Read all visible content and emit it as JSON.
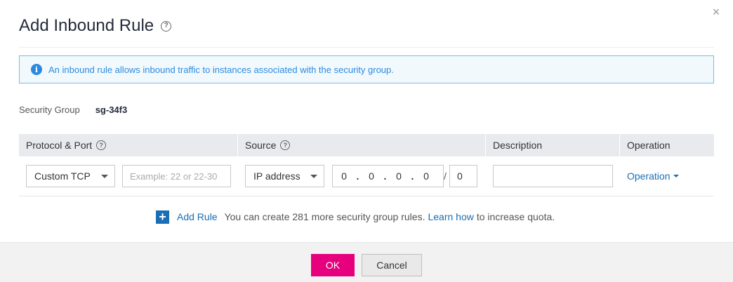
{
  "dialog": {
    "title": "Add Inbound Rule",
    "help_glyph": "?",
    "close_glyph": "×"
  },
  "info": {
    "icon_glyph": "i",
    "text": "An inbound rule allows inbound traffic to instances associated with the security group."
  },
  "security_group": {
    "label": "Security Group",
    "value": "sg-34f3"
  },
  "table": {
    "headers": {
      "protocol_port": "Protocol & Port",
      "source": "Source",
      "description": "Description",
      "operation": "Operation"
    },
    "row": {
      "protocol": "Custom TCP",
      "port_placeholder": "Example: 22 or 22-30",
      "port_value": "",
      "source_type": "IP address",
      "ip": [
        "0",
        "0",
        "0",
        "0"
      ],
      "ip_dot": ".",
      "mask_separator": "/",
      "mask": "0",
      "description": "",
      "operation_label": "Operation"
    }
  },
  "add_rule": {
    "icon_glyph": "+",
    "label": "Add Rule",
    "quota_text": "You can create 281 more security group rules.",
    "learn_link": "Learn how",
    "quota_suffix": "to increase quota."
  },
  "footer": {
    "ok_label": "OK",
    "cancel_label": "Cancel"
  },
  "colors": {
    "accent_pink": "#e6007e",
    "link_blue": "#1b6eb5",
    "info_blue": "#2b8ae0",
    "header_gray": "#e8eaee"
  }
}
